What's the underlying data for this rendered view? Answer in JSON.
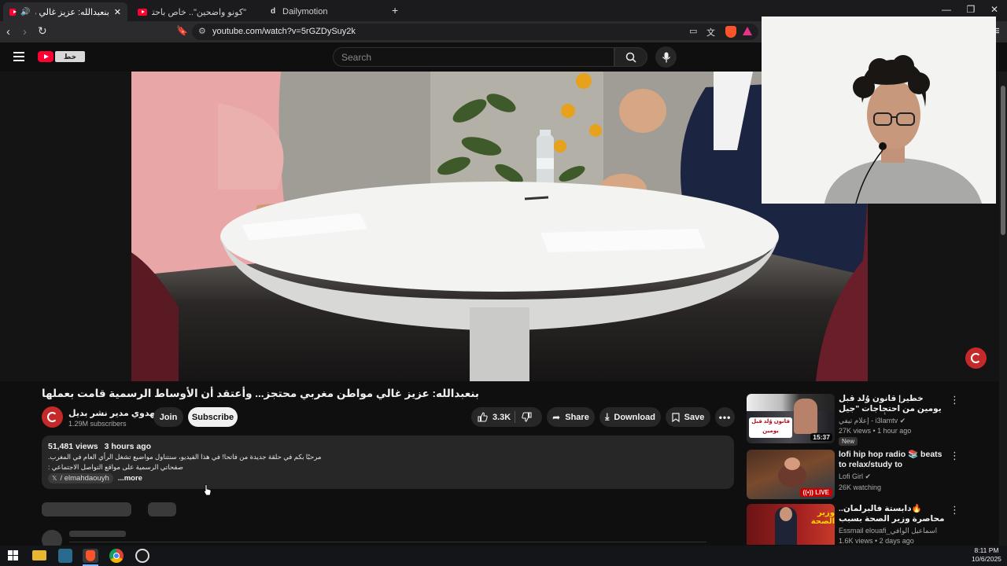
{
  "browser": {
    "tabs": [
      {
        "title": "بنعبدالله: عزيز غالي مواطن مغ",
        "favicon": "youtube-icon"
      },
      {
        "title": "\"كونو واضحين\".. خاص باحتجاجات الشا",
        "favicon": "youtube-icon"
      },
      {
        "title": "Dailymotion",
        "favicon": "dailymotion-icon"
      }
    ],
    "url": "youtube.com/watch?v=5rGZDySuy2k"
  },
  "header": {
    "search_placeholder": "Search",
    "logo_badge": "خط"
  },
  "video": {
    "title": "بنعبدالله: عزيز غالي مواطن مغربي محتجز... وأعتقد أن الأوساط الرسمية قامت بعملها",
    "channel_name": "المهدوي مدير نشر بديل",
    "subscribers": "1.29M subscribers",
    "join_label": "Join",
    "subscribe_label": "Subscribe",
    "likes": "3.3K",
    "share_label": "Share",
    "download_label": "Download",
    "save_label": "Save"
  },
  "description": {
    "views": "51,481 views",
    "time": "3 hours ago",
    "line1": "مرحبًا بكم في حلقة جديدة من فاتحا! في هذا الفيديو، سنتناول مواضيع تشغل الرأي العام في المغرب.",
    "line2": "صفحاتي الرسمية على مواقع التواصل الاجتماعي :",
    "handle": "/ elmahdaouyh",
    "more_label": "...more"
  },
  "sidebar": {
    "items": [
      {
        "title": "خطير| قانون وُلد قبل يومين من احتجاجات \"جيل Z\" لتكميم الأفواه ... هذه المطالب التي",
        "channel": "إعلام تيفي - i3lamtv",
        "meta": "27K views • 1 hour ago",
        "badge": "New",
        "duration": "15:37"
      },
      {
        "title": "lofi hip hop radio 📚 beats to relax/study to",
        "channel": "Lofi Girl",
        "meta": "26K watching",
        "badge": "LIVE"
      },
      {
        "title": "🔥دابستة فالبرلمان.. محاصرة وزير الصحة بسبب احتجاجات جيل Z",
        "channel": "Essmail elouafi_اسماعيل الوافي",
        "meta": "1.6K views • 2 days ago",
        "badge": ""
      }
    ]
  },
  "taskbar": {
    "time": "8:11 PM",
    "date": "10/6/2025"
  }
}
